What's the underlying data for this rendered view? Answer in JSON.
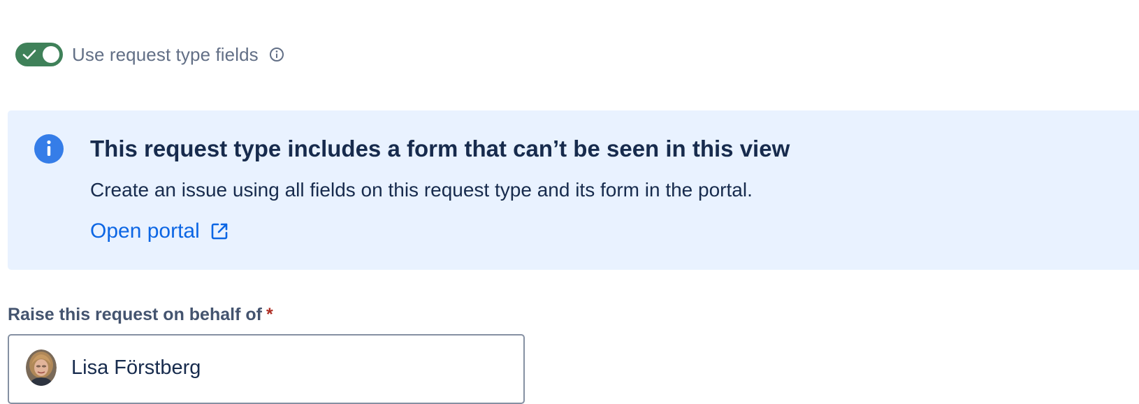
{
  "toggle": {
    "label": "Use request type fields",
    "checked": true,
    "on_color": "#3F8159",
    "icons": [
      "check-icon",
      "info-icon"
    ]
  },
  "banner": {
    "icon": "info-circle-icon",
    "title": "This request type includes a form that can’t be seen in this view",
    "description": "Create an issue using all fields on this request type and its form in the portal.",
    "link_label": "Open portal",
    "link_icon": "external-link-icon",
    "background_color": "#E9F2FF",
    "accent_color": "#1D7AFC"
  },
  "raise_on_behalf": {
    "label": "Raise this request on behalf of",
    "required_marker": "*",
    "selected_user": "Lisa Förstberg",
    "avatar_icon": "user-avatar"
  }
}
